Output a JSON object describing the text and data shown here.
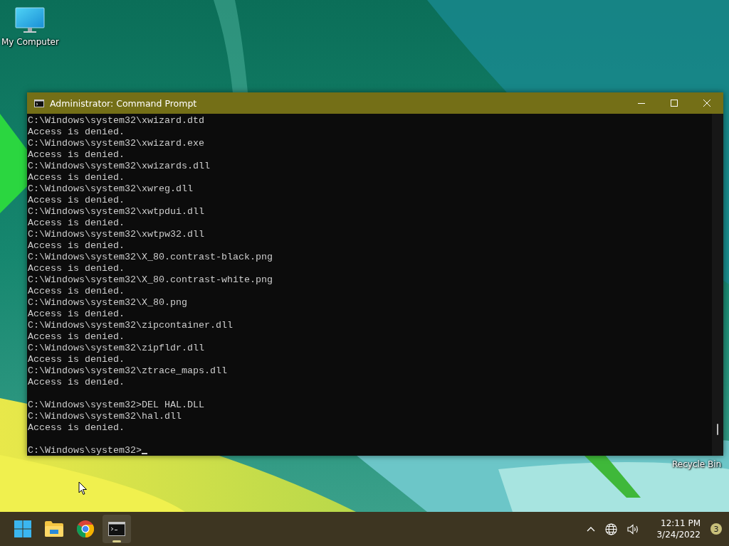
{
  "desktop": {
    "icons": [
      {
        "kind": "computer",
        "label": "My Computer"
      },
      {
        "kind": "recycle-bin",
        "label": "Recycle Bin"
      }
    ]
  },
  "window": {
    "title": "Administrator: Command Prompt",
    "lines": [
      {
        "text": "C:\\Windows\\system32\\xwizard.dtd"
      },
      {
        "text": "Access is denied."
      },
      {
        "text": "C:\\Windows\\system32\\xwizard.exe"
      },
      {
        "text": "Access is denied."
      },
      {
        "text": "C:\\Windows\\system32\\xwizards.dll"
      },
      {
        "text": "Access is denied."
      },
      {
        "text": "C:\\Windows\\system32\\xwreg.dll"
      },
      {
        "text": "Access is denied."
      },
      {
        "text": "C:\\Windows\\system32\\xwtpdui.dll"
      },
      {
        "text": "Access is denied."
      },
      {
        "text": "C:\\Windows\\system32\\xwtpw32.dll"
      },
      {
        "text": "Access is denied."
      },
      {
        "text": "C:\\Windows\\system32\\X_80.contrast-black.png"
      },
      {
        "text": "Access is denied."
      },
      {
        "text": "C:\\Windows\\system32\\X_80.contrast-white.png"
      },
      {
        "text": "Access is denied."
      },
      {
        "text": "C:\\Windows\\system32\\X_80.png"
      },
      {
        "text": "Access is denied."
      },
      {
        "text": "C:\\Windows\\system32\\zipcontainer.dll"
      },
      {
        "text": "Access is denied."
      },
      {
        "text": "C:\\Windows\\system32\\zipfldr.dll"
      },
      {
        "text": "Access is denied."
      },
      {
        "text": "C:\\Windows\\system32\\ztrace_maps.dll"
      },
      {
        "text": "Access is denied."
      },
      {
        "text": "C:\\Windows\\system32>DEL HAL.DLL",
        "gap_before": true
      },
      {
        "text": "C:\\Windows\\system32\\hal.dll"
      },
      {
        "text": "Access is denied."
      },
      {
        "text": "C:\\Windows\\system32>",
        "gap_before": true,
        "cursor": true
      }
    ]
  },
  "taskbar": {
    "apps": [
      {
        "kind": "start",
        "selected": false
      },
      {
        "kind": "explorer",
        "selected": false
      },
      {
        "kind": "browser",
        "selected": false
      },
      {
        "kind": "terminal",
        "selected": true
      }
    ],
    "tray": {
      "time": "12:11 PM",
      "date": "3/24/2022",
      "notifications": "3"
    }
  }
}
